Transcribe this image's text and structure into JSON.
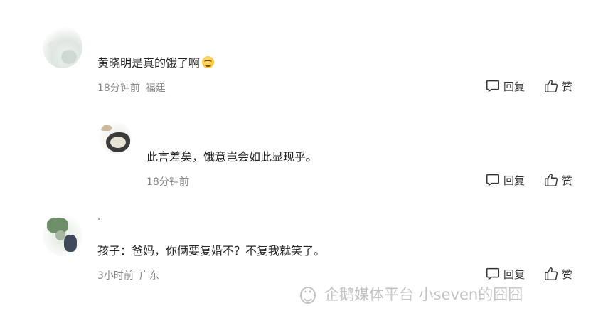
{
  "comments": [
    {
      "content": "黄晓明是真的饿了啊",
      "time": "18分钟前",
      "location": "福建",
      "reply_label": "回复",
      "like_label": "赞"
    },
    {
      "content": "此言差矣，饿意岂会如此显现乎。",
      "time": "18分钟前",
      "location": "",
      "reply_label": "回复",
      "like_label": "赞"
    },
    {
      "nickname": "·",
      "content": "孩子：爸妈，你俩要复婚不？不复我就笑了。",
      "time": "3小时前",
      "location": "广东",
      "reply_label": "回复",
      "like_label": "赞"
    }
  ],
  "watermark": {
    "text": "企鹅媒体平台 小seven的囧囧",
    "icon": "penguin-icon"
  },
  "icons": {
    "reply": "comment-bubble-icon",
    "like": "thumbs-up-icon",
    "emoji": "smile-emoji-icon"
  }
}
